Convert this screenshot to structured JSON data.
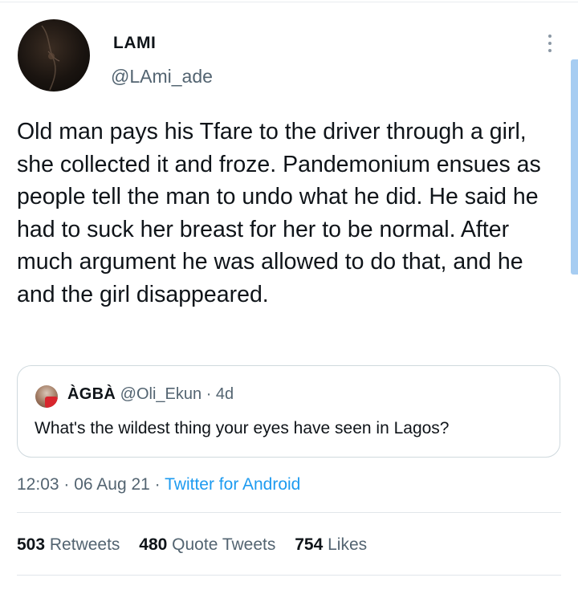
{
  "author": {
    "name": "LAMI",
    "handle": "@LAmi_ade"
  },
  "tweet": {
    "text": "Old man pays his Tfare to the driver through a girl, she collected it and froze. Pandemonium ensues as people tell the man to undo what he did. He said he had to suck her breast for her to be normal. After much argument he was allowed to do that, and he and the girl disappeared."
  },
  "quoted_tweet": {
    "name": "ÀGBÀ",
    "handle": "@Oli_Ekun",
    "age": "4d",
    "text": "What's the wildest thing your eyes have seen in Lagos?"
  },
  "meta": {
    "time": "12:03",
    "date": "06 Aug 21",
    "source": "Twitter for Android"
  },
  "stats": {
    "retweets": {
      "count": "503",
      "label": "Retweets"
    },
    "quote_tweets": {
      "count": "480",
      "label": "Quote Tweets"
    },
    "likes": {
      "count": "754",
      "label": "Likes"
    }
  },
  "colors": {
    "link": "#1d9bf0",
    "secondary_text": "#536471",
    "primary_text": "#0f1419",
    "scrollbar": "#a7cdf2"
  },
  "icons": {
    "more": "more-vertical-icon"
  }
}
